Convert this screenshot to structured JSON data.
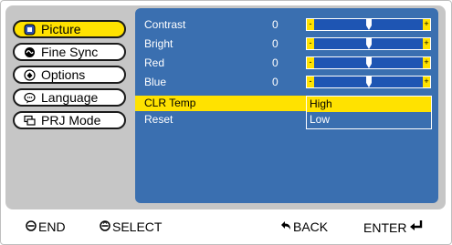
{
  "tabs": [
    {
      "label": "Picture",
      "icon": "picture-icon",
      "active": true
    },
    {
      "label": "Fine Sync",
      "icon": "fine-sync-icon",
      "active": false
    },
    {
      "label": "Options",
      "icon": "options-icon",
      "active": false
    },
    {
      "label": "Language",
      "icon": "language-icon",
      "active": false
    },
    {
      "label": "PRJ Mode",
      "icon": "prj-mode-icon",
      "active": false
    }
  ],
  "settings": [
    {
      "label": "Contrast",
      "value": "0",
      "has_slider": true,
      "slider_minus": "-",
      "slider_plus": "+",
      "level": 0.5
    },
    {
      "label": "Bright",
      "value": "0",
      "has_slider": true,
      "slider_minus": "-",
      "slider_plus": "+",
      "level": 0.5
    },
    {
      "label": "Red",
      "value": "0",
      "has_slider": true,
      "slider_minus": "-",
      "slider_plus": "+",
      "level": 0.5
    },
    {
      "label": "Blue",
      "value": "0",
      "has_slider": true,
      "slider_minus": "-",
      "slider_plus": "+",
      "level": 0.5
    },
    {
      "label": "CLR Temp",
      "value": "",
      "has_slider": false,
      "selected": true
    },
    {
      "label": "Reset",
      "value": "",
      "has_slider": false
    }
  ],
  "clr_temp_options": {
    "items": [
      "High",
      "Low"
    ],
    "selected_index": 0
  },
  "bottom_bar": {
    "end_label": "END",
    "select_label": "SELECT",
    "back_label": "BACK",
    "enter_label": "ENTER"
  },
  "colors": {
    "menu_background": "#c6c6c6",
    "content_background": "#3a6fb0",
    "highlight": "#ffe200",
    "slider_track": "#1e55b3"
  }
}
